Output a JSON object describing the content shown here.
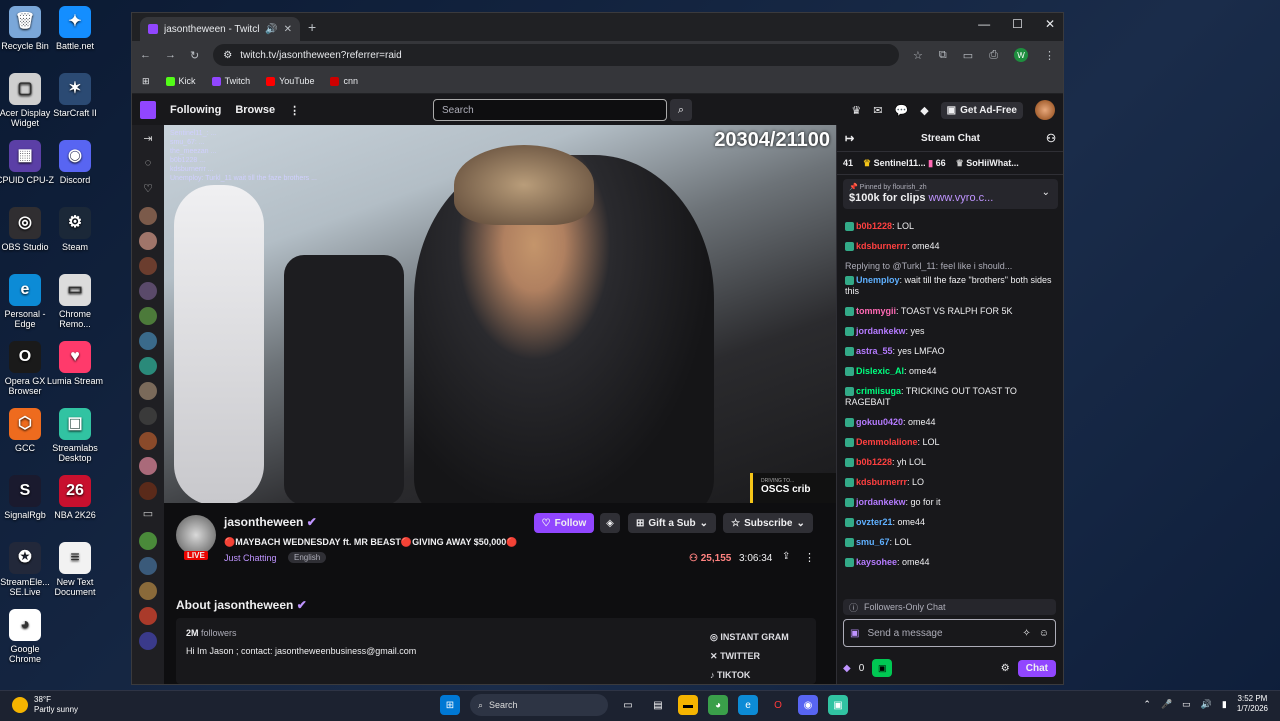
{
  "desktop": {
    "icons": [
      {
        "label": "Recycle Bin",
        "col": 0,
        "row": 0,
        "color": "#7aa7d9",
        "glyph": "🗑"
      },
      {
        "label": "Battle.net",
        "col": 1,
        "row": 0,
        "color": "#148eff",
        "glyph": "✦"
      },
      {
        "label": "Acer Display Widget",
        "col": 0,
        "row": 1,
        "color": "#cfcfcf",
        "glyph": "▢"
      },
      {
        "label": "StarCraft II",
        "col": 1,
        "row": 1,
        "color": "#2b4a73",
        "glyph": "✶"
      },
      {
        "label": "CPUID CPU-Z",
        "col": 0,
        "row": 2,
        "color": "#5b3fa6",
        "glyph": "▦"
      },
      {
        "label": "Discord",
        "col": 1,
        "row": 2,
        "color": "#5865f2",
        "glyph": "◉"
      },
      {
        "label": "OBS Studio",
        "col": 0,
        "row": 3,
        "color": "#302e31",
        "glyph": "◎"
      },
      {
        "label": "Steam",
        "col": 1,
        "row": 3,
        "color": "#1b2838",
        "glyph": "⚙"
      },
      {
        "label": "Personal - Edge",
        "col": 0,
        "row": 4,
        "color": "#0c8bd6",
        "glyph": "e"
      },
      {
        "label": "Chrome Remo...",
        "col": 1,
        "row": 4,
        "color": "#dcdcdc",
        "glyph": "▭"
      },
      {
        "label": "Opera GX Browser",
        "col": 0,
        "row": 5,
        "color": "#1a1a1a",
        "glyph": "O"
      },
      {
        "label": "Lumia Stream",
        "col": 1,
        "row": 5,
        "color": "#ff3a6b",
        "glyph": "♥"
      },
      {
        "label": "GCC",
        "col": 0,
        "row": 6,
        "color": "#ee6b1e",
        "glyph": "⬡"
      },
      {
        "label": "Streamlabs Desktop",
        "col": 1,
        "row": 6,
        "color": "#31c3a2",
        "glyph": "▣"
      },
      {
        "label": "SignalRgb",
        "col": 0,
        "row": 7,
        "color": "#1a1a2e",
        "glyph": "S"
      },
      {
        "label": "NBA 2K26",
        "col": 1,
        "row": 7,
        "color": "#c8102e",
        "glyph": "26"
      },
      {
        "label": "StreamEle... SE.Live",
        "col": 0,
        "row": 8,
        "color": "#22283a",
        "glyph": "✪"
      },
      {
        "label": "New Text Document",
        "col": 1,
        "row": 8,
        "color": "#f2f2f2",
        "glyph": "≡"
      },
      {
        "label": "Google Chrome",
        "col": 0,
        "row": 9,
        "color": "#ffffff",
        "glyph": "◕"
      }
    ]
  },
  "browser": {
    "tab_title": "jasontheween - Twitch",
    "url": "twitch.tv/jasontheween?referrer=raid",
    "profile_letter": "W",
    "bookmarks": [
      {
        "label": "Kick",
        "color": "#53fc18"
      },
      {
        "label": "Twitch",
        "color": "#9146ff"
      },
      {
        "label": "YouTube",
        "color": "#ff0000"
      },
      {
        "label": "cnn",
        "color": "#cc0000"
      }
    ]
  },
  "twitch": {
    "nav_following": "Following",
    "nav_browse": "Browse",
    "search_placeholder": "Search",
    "get_ad_free": "Get Ad-Free"
  },
  "video": {
    "counter": "20304/21100",
    "overlay_chat": [
      "Sentinel11_: ...",
      "smu_67: ...",
      "the_meezan ...",
      "b0b1228 ...",
      "kdsburnerrr ...",
      "Unemploy: Turkl_11 wait till the faze brothers ..."
    ],
    "driving_small": "DRIVING TO...",
    "driving_label": "OSCS crib"
  },
  "stream": {
    "channel": "jasontheween",
    "live": "LIVE",
    "title": "🔴MAYBACH WEDNESDAY ft. MR BEAST🔴GIVING AWAY $50,000🔴",
    "category": "Just Chatting",
    "tag": "English",
    "follow": "Follow",
    "gift": "Gift a Sub",
    "subscribe": "Subscribe",
    "viewers": "25,155",
    "uptime": "3:06:34",
    "about_title": "About jasontheween",
    "followers_count": "2M",
    "followers_label": "followers",
    "bio": "Hi Im Jason ; contact: jasontheweenbusiness@gmail.com",
    "links": [
      "INSTANT GRAM",
      "TWITTER",
      "TIKTOK"
    ]
  },
  "chat": {
    "title": "Stream Chat",
    "leaderboard": [
      {
        "rank": "41",
        "name": "",
        "count": ""
      },
      {
        "rank": "",
        "name": "Sentinel11...",
        "count": "66"
      },
      {
        "rank": "",
        "name": "SoHiiWhat...",
        "count": ""
      }
    ],
    "pinned_by": "Pinned by",
    "pinned_user": "flourish_zh",
    "pinned_msg": "$100k for clips",
    "pinned_link": "www.vyro.c...",
    "messages": [
      {
        "user": "b0b1228",
        "color": "#ff4040",
        "text": "LOL"
      },
      {
        "user": "kdsburnerrr",
        "color": "#ff4040",
        "text": "ome44"
      },
      {
        "reply": "Replying to @Turkl_11: feel like i should...",
        "user": "Unemploy",
        "color": "#5fb0ff",
        "text": "wait till the faze \"brothers\" both sides this"
      },
      {
        "user": "tommygii",
        "color": "#ff69b4",
        "text": "TOAST VS RALPH FOR 5K"
      },
      {
        "user": "jordankekw",
        "color": "#b57bff",
        "text": "yes"
      },
      {
        "user": "astra_55",
        "color": "#b57bff",
        "text": "yes LMFAO"
      },
      {
        "user": "Dislexic_Al",
        "color": "#00ff7f",
        "text": "ome44"
      },
      {
        "user": "crimiisuga",
        "color": "#00ff7f",
        "text": "TRICKING OUT TOAST TO RAGEBAIT"
      },
      {
        "user": "gokuu0420",
        "color": "#b57bff",
        "text": "ome44"
      },
      {
        "user": "Demmolalione",
        "color": "#ff4040",
        "text": "LOL"
      },
      {
        "user": "b0b1228",
        "color": "#ff4040",
        "text": "yh LOL"
      },
      {
        "user": "kdsburnerrr",
        "color": "#ff4040",
        "text": "LO"
      },
      {
        "user": "jordankekw",
        "color": "#b57bff",
        "text": "go for it"
      },
      {
        "user": "ovzter21",
        "color": "#5fb0ff",
        "text": "ome44"
      },
      {
        "user": "smu_67",
        "color": "#5fb0ff",
        "text": "LOL"
      },
      {
        "user": "kaysohee",
        "color": "#b57bff",
        "text": "ome44"
      }
    ],
    "followers_only": "Followers-Only Chat",
    "input_placeholder": "Send a message",
    "points": "0",
    "chat_button": "Chat"
  },
  "taskbar": {
    "temp": "38°F",
    "weather": "Partly sunny",
    "search": "Search",
    "time": "3:52 PM",
    "date": "1/7/2026"
  }
}
